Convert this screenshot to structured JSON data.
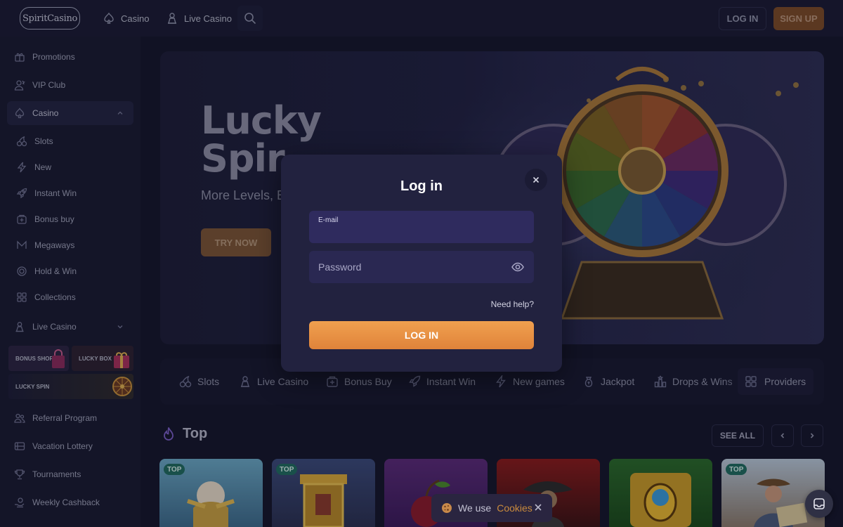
{
  "header": {
    "logo_text": "SpiritCasino",
    "nav": [
      {
        "label": "Casino",
        "icon": "spade-icon"
      },
      {
        "label": "Live Casino",
        "icon": "dealer-icon"
      }
    ],
    "login_label": "LOG IN",
    "signup_label": "SIGN UP"
  },
  "sidebar": {
    "items": [
      {
        "label": "Promotions",
        "icon": "gift-icon"
      },
      {
        "label": "VIP Club",
        "icon": "user-icon"
      },
      {
        "label": "Casino",
        "icon": "spade-icon"
      }
    ],
    "casino_sub": [
      {
        "label": "Slots",
        "icon": "cherry-icon"
      },
      {
        "label": "New",
        "icon": "lightning-icon"
      },
      {
        "label": "Instant Win",
        "icon": "rocket-icon"
      },
      {
        "label": "Bonus buy",
        "icon": "bonus-icon"
      },
      {
        "label": "Megaways",
        "icon": "megaways-icon"
      },
      {
        "label": "Hold & Win",
        "icon": "coin-icon"
      },
      {
        "label": "Collections",
        "icon": "grid-icon"
      }
    ],
    "live_casino_label": "Live Casino",
    "promo_tiles": {
      "bonus_shop": "BONUS SHOP",
      "lucky_box": "LUCKY BOX",
      "lucky_spin": "LUCKY SPIN"
    },
    "bottom_items": [
      {
        "label": "Referral Program",
        "icon": "referral-icon"
      },
      {
        "label": "Vacation Lottery",
        "icon": "ticket-icon"
      },
      {
        "label": "Tournaments",
        "icon": "trophy-icon"
      },
      {
        "label": "Weekly Cashback",
        "icon": "cashback-icon"
      }
    ]
  },
  "hero": {
    "title_line1": "Lucky",
    "title_line2": "Spir",
    "subtitle": "More Levels, Bo",
    "cta_label": "TRY NOW"
  },
  "categories": [
    {
      "label": "Slots",
      "icon": "cherry-icon"
    },
    {
      "label": "Live Casino",
      "icon": "dealer-icon"
    },
    {
      "label": "Bonus Buy",
      "icon": "bonus-icon"
    },
    {
      "label": "Instant Win",
      "icon": "rocket-icon"
    },
    {
      "label": "New games",
      "icon": "lightning-icon"
    },
    {
      "label": "Jackpot",
      "icon": "jackpot-icon"
    },
    {
      "label": "Drops & Wins",
      "icon": "drops-icon"
    }
  ],
  "providers_label": "Providers",
  "top_section": {
    "title": "Top",
    "see_all_label": "SEE ALL",
    "badge_label": "TOP",
    "cards": [
      {
        "badge": true,
        "theme": "zeus"
      },
      {
        "badge": true,
        "theme": "egypt"
      },
      {
        "badge": false,
        "theme": "fruit"
      },
      {
        "badge": false,
        "theme": "western"
      },
      {
        "badge": false,
        "theme": "beetle"
      },
      {
        "badge": true,
        "theme": "explorer"
      }
    ]
  },
  "login_modal": {
    "title": "Log in",
    "email_label": "E-mail",
    "email_value": "",
    "password_placeholder": "Password",
    "need_help_label": "Need help?",
    "submit_label": "LOG IN"
  },
  "cookie_bar": {
    "text": "We use",
    "link_label": "Cookies"
  },
  "colors": {
    "accent_orange": "#f0a04f",
    "badge_green": "#1f6b5f",
    "modal_bg": "#22223f",
    "page_bg": "#14152a"
  }
}
